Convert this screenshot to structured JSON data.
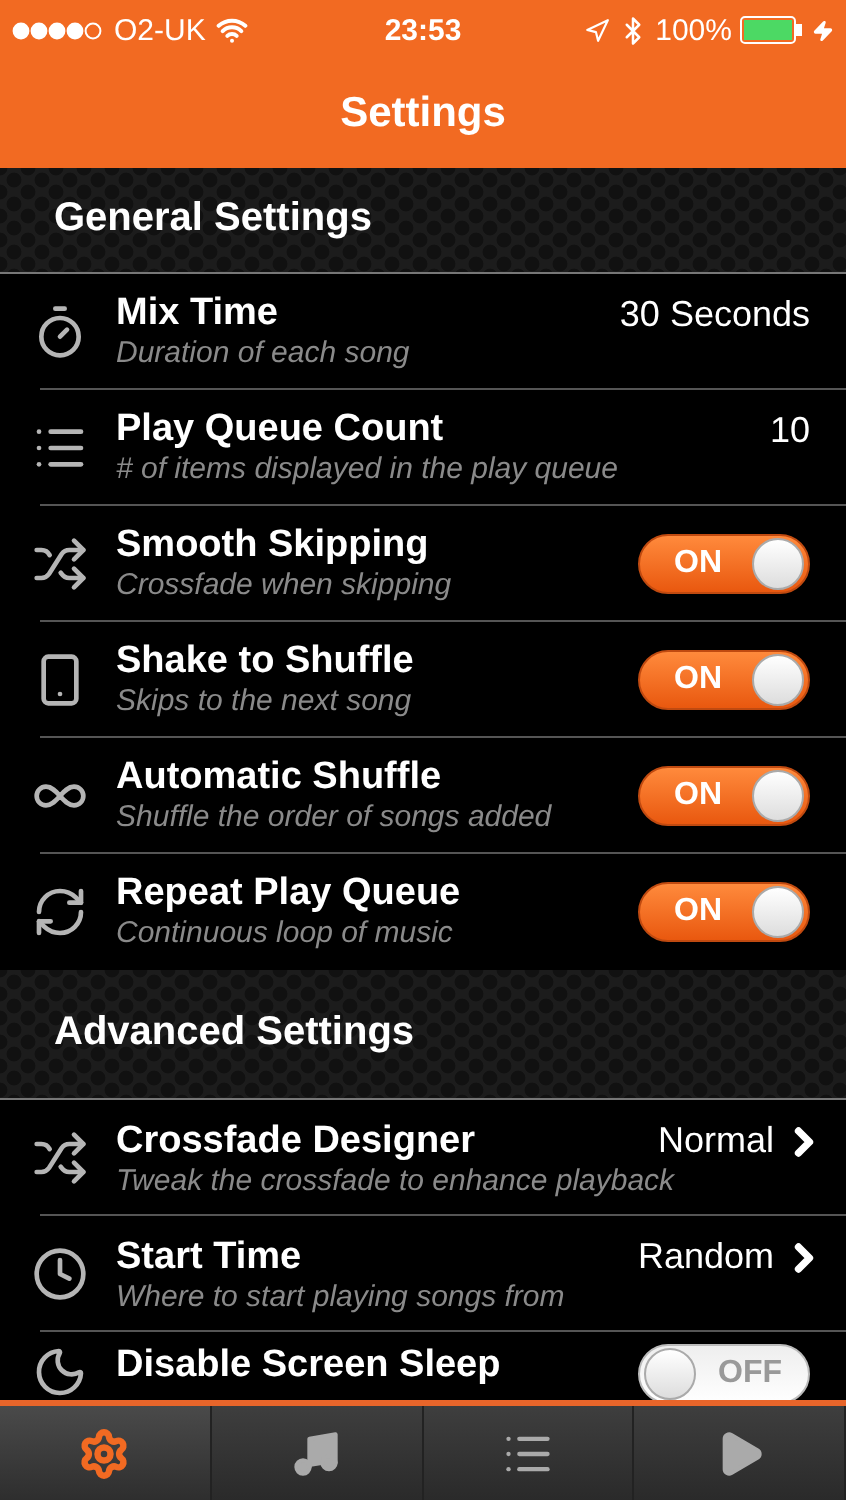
{
  "status_bar": {
    "carrier": "O2-UK",
    "time": "23:53",
    "battery": "100%"
  },
  "nav": {
    "title": "Settings"
  },
  "sections": [
    {
      "title": "General Settings",
      "rows": [
        {
          "kind": "value",
          "title": "Mix Time",
          "subtitle": "Duration of each song",
          "value": "30 Seconds"
        },
        {
          "kind": "value",
          "title": "Play Queue Count",
          "subtitle": "# of items displayed in the play queue",
          "value": "10"
        },
        {
          "kind": "toggle",
          "title": "Smooth Skipping",
          "subtitle": "Crossfade when skipping",
          "on": true,
          "label": "ON"
        },
        {
          "kind": "toggle",
          "title": "Shake to Shuffle",
          "subtitle": "Skips to the next song",
          "on": true,
          "label": "ON"
        },
        {
          "kind": "toggle",
          "title": "Automatic Shuffle",
          "subtitle": "Shuffle the order of songs added",
          "on": true,
          "label": "ON"
        },
        {
          "kind": "toggle",
          "title": "Repeat Play Queue",
          "subtitle": "Continuous loop of music",
          "on": true,
          "label": "ON"
        }
      ]
    },
    {
      "title": "Advanced Settings",
      "rows": [
        {
          "kind": "link",
          "title": "Crossfade Designer",
          "subtitle": "Tweak the crossfade to enhance playback",
          "value": "Normal"
        },
        {
          "kind": "link",
          "title": "Start Time",
          "subtitle": "Where to start playing songs from",
          "value": "Random"
        },
        {
          "kind": "toggle",
          "title": "Disable Screen Sleep",
          "on": false,
          "label": "OFF"
        }
      ]
    }
  ],
  "tab_bar": [
    {
      "selected": true
    },
    {
      "selected": false
    },
    {
      "selected": false
    },
    {
      "selected": false
    }
  ]
}
